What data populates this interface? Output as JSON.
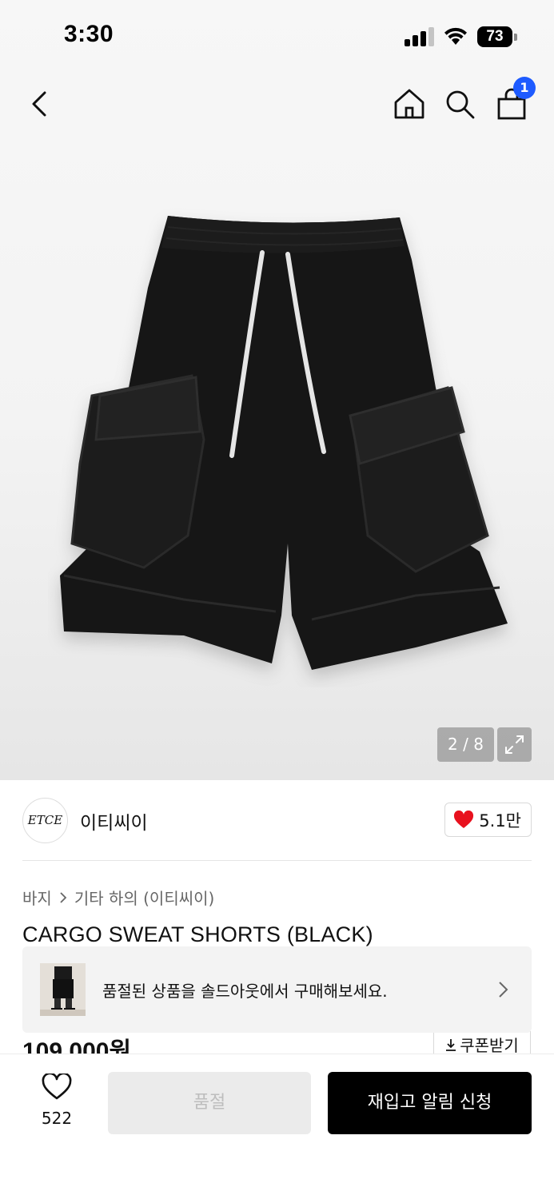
{
  "status_bar": {
    "time": "3:30",
    "battery": "73",
    "icons": [
      "signal-icon",
      "wifi-icon",
      "battery-icon"
    ]
  },
  "nav": {
    "icons": [
      "back-icon",
      "home-icon",
      "search-icon",
      "cart-icon"
    ],
    "cart_count": "1"
  },
  "gallery": {
    "counter": "2 / 8",
    "expand_icon": "expand-icon"
  },
  "brand": {
    "logo_text": "ETCE",
    "name": "이티씨이",
    "likes": "5.1만",
    "like_color": "#e8111e"
  },
  "product": {
    "breadcrumb": [
      "바지",
      "기타 하의 (이티씨이)"
    ],
    "title": "CARGO SWEAT SHORTS (BLACK)",
    "price": "109,000원",
    "coupon_label": "쿠폰받기"
  },
  "soldout_banner": {
    "text": "품절된 상품을 솔드아웃에서 구매해보세요."
  },
  "bottom_bar": {
    "wish_count": "522",
    "soldout_label": "품절",
    "restock_label": "재입고 알림 신청"
  },
  "colors": {
    "accent_blue": "#1e5bff",
    "primary_button": "#000000",
    "disabled_button": "#ebebeb"
  }
}
